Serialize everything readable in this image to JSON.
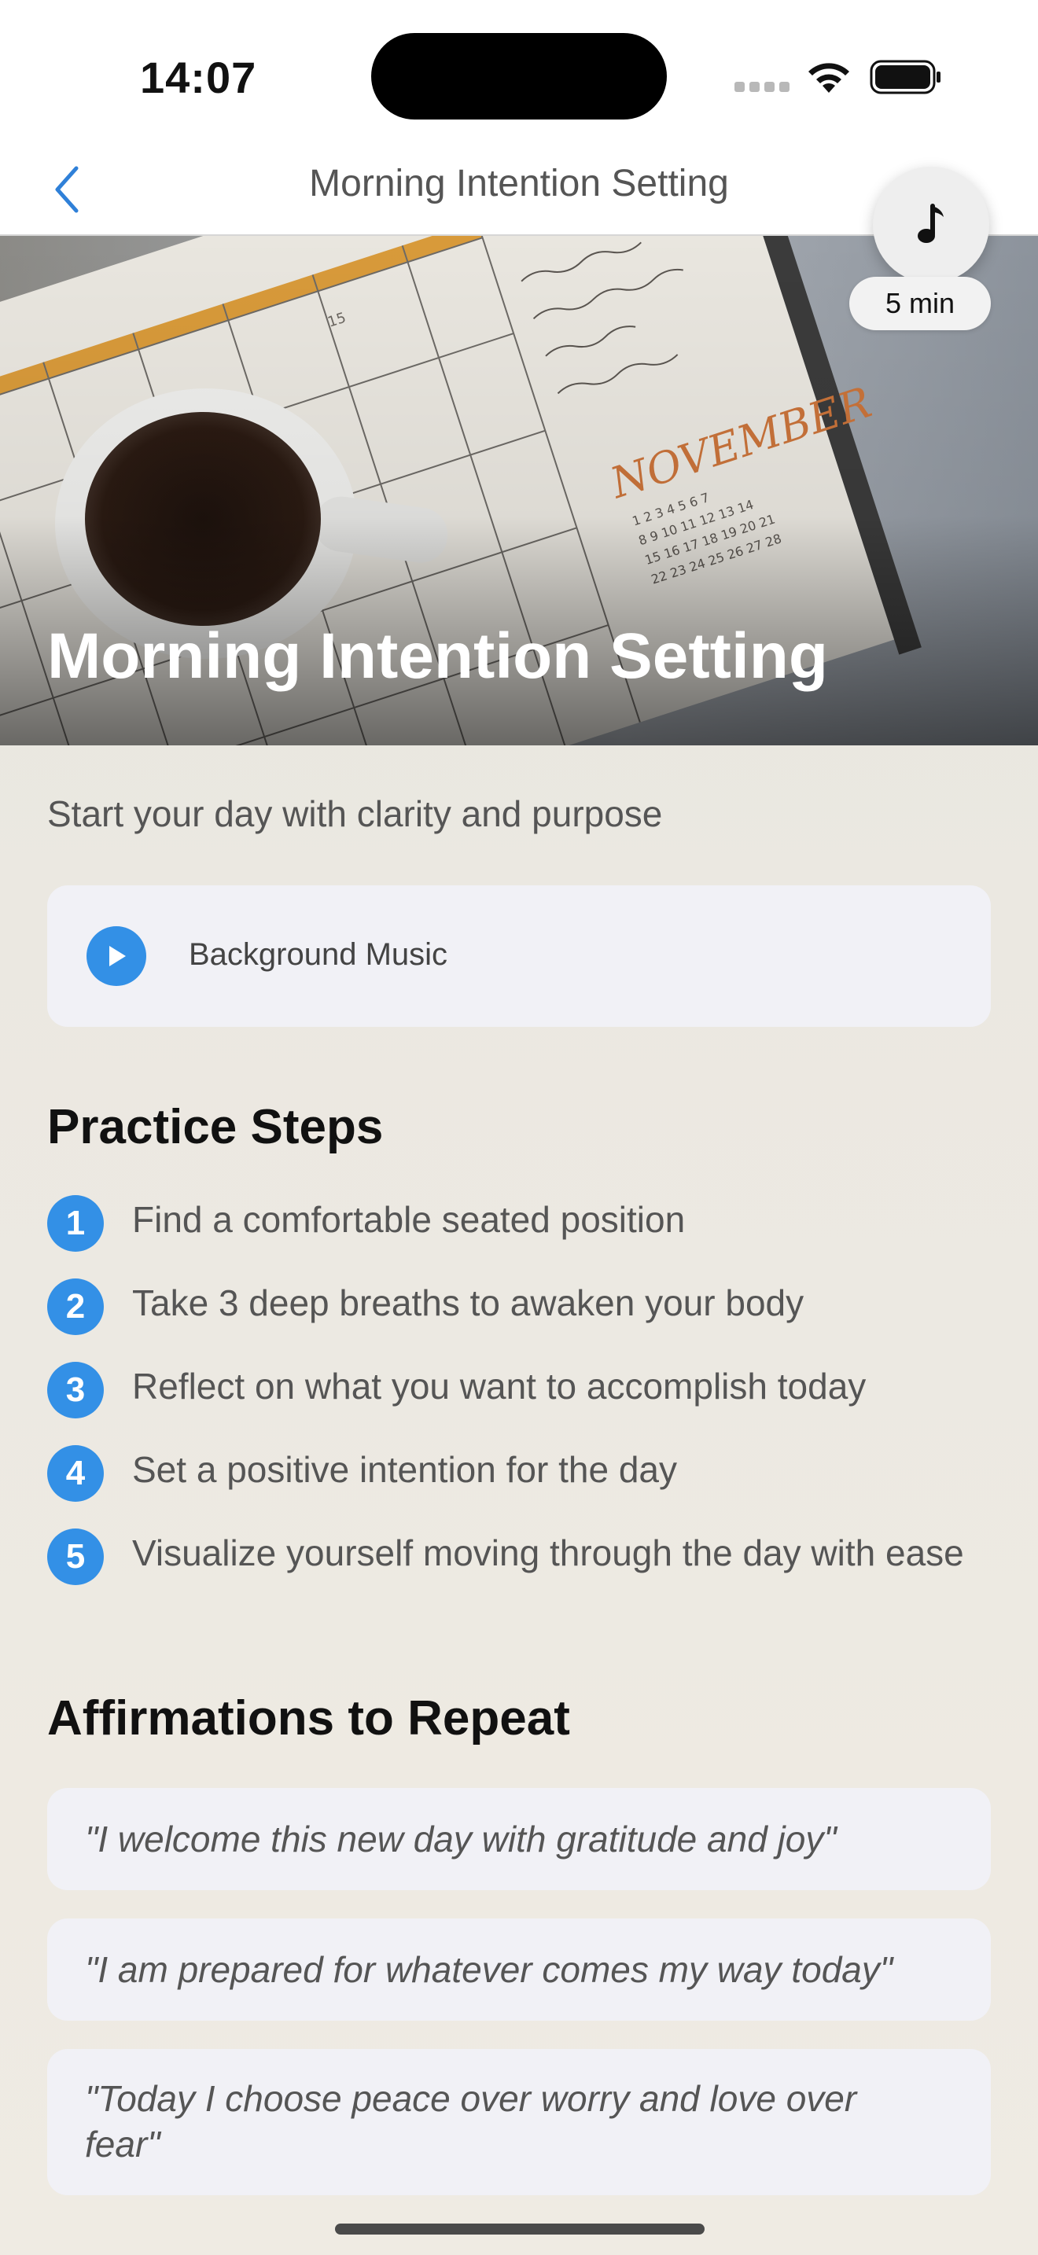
{
  "status": {
    "time": "14:07"
  },
  "nav": {
    "title": "Morning Intention Setting",
    "back_icon": "chevron-left-icon"
  },
  "hero": {
    "title": "Morning Intention Setting",
    "image_description_icon": "coffee-calendar-photo",
    "calendar_month": "NOVEMBER"
  },
  "music": {
    "fab_icon": "music-note-icon",
    "duration": "5 min"
  },
  "subtitle": "Start your day with clarity and purpose",
  "background_music": {
    "label": "Background Music",
    "icon": "play-icon"
  },
  "practice": {
    "title": "Practice Steps",
    "steps": [
      {
        "num": "1",
        "text": "Find a comfortable seated position"
      },
      {
        "num": "2",
        "text": "Take 3 deep breaths to awaken your body"
      },
      {
        "num": "3",
        "text": "Reflect on what you want to accomplish today"
      },
      {
        "num": "4",
        "text": "Set a positive intention for the day"
      },
      {
        "num": "5",
        "text": "Visualize yourself moving through the day with ease"
      }
    ]
  },
  "affirmations": {
    "title": "Affirmations to Repeat",
    "items": [
      "\"I welcome this new day with gratitude and joy\"",
      "\"I am prepared for whatever comes my way today\"",
      "\"Today I choose peace over worry and love over fear\""
    ]
  },
  "colors": {
    "accent": "#3390e6",
    "card": "#f1f1f6",
    "background": "#e8e5df"
  }
}
